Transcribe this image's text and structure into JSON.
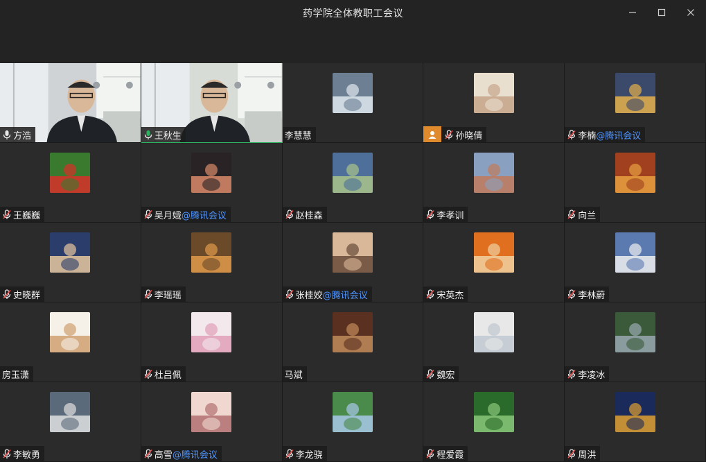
{
  "window": {
    "title": "药学院全体教职工会议",
    "controls": [
      "minimize-icon",
      "maximize-icon",
      "close-icon"
    ]
  },
  "colors": {
    "background": "#232323",
    "tile": "#2b2b2b",
    "speaking_border": "#2db35d",
    "link_blue": "#4f95ff",
    "host_badge": "#e08a2e",
    "muted_red": "#e84c4c"
  },
  "participants": [
    {
      "name": "方浩",
      "suffix": "",
      "mic": "active",
      "tile": "video"
    },
    {
      "name": "王秋生",
      "suffix": "",
      "mic": "speaking",
      "tile": "video"
    },
    {
      "name": "李慧慧",
      "suffix": "",
      "mic": "none",
      "tile": "avatar"
    },
    {
      "name": "孙晓倩",
      "suffix": "",
      "mic": "muted",
      "tile": "avatar",
      "badge": "host-icon"
    },
    {
      "name": "李楠",
      "suffix": "@腾讯会议",
      "mic": "muted",
      "tile": "avatar"
    },
    {
      "name": "王巍巍",
      "suffix": "",
      "mic": "muted",
      "tile": "avatar"
    },
    {
      "name": "吴月娥",
      "suffix": "@腾讯会议",
      "mic": "muted",
      "tile": "avatar"
    },
    {
      "name": "赵桂森",
      "suffix": "",
      "mic": "muted",
      "tile": "avatar"
    },
    {
      "name": "李孝训",
      "suffix": "",
      "mic": "muted",
      "tile": "avatar"
    },
    {
      "name": "向兰",
      "suffix": "",
      "mic": "muted",
      "tile": "avatar"
    },
    {
      "name": "史晓群",
      "suffix": "",
      "mic": "muted",
      "tile": "avatar"
    },
    {
      "name": "李瑶瑶",
      "suffix": "",
      "mic": "muted",
      "tile": "avatar"
    },
    {
      "name": "张桂姣",
      "suffix": "@腾讯会议",
      "mic": "muted",
      "tile": "avatar"
    },
    {
      "name": "宋英杰",
      "suffix": "",
      "mic": "muted",
      "tile": "avatar"
    },
    {
      "name": "李林蔚",
      "suffix": "",
      "mic": "muted",
      "tile": "avatar"
    },
    {
      "name": "房玉潇",
      "suffix": "",
      "mic": "none",
      "tile": "avatar"
    },
    {
      "name": "杜吕佩",
      "suffix": "",
      "mic": "muted",
      "tile": "avatar"
    },
    {
      "name": "马斌",
      "suffix": "",
      "mic": "none",
      "tile": "avatar"
    },
    {
      "name": "魏宏",
      "suffix": "",
      "mic": "muted",
      "tile": "avatar"
    },
    {
      "name": "李凌冰",
      "suffix": "",
      "mic": "muted",
      "tile": "avatar"
    },
    {
      "name": "李敏勇",
      "suffix": "",
      "mic": "muted",
      "tile": "avatar"
    },
    {
      "name": "高雪",
      "suffix": "@腾讯会议",
      "mic": "muted",
      "tile": "avatar"
    },
    {
      "name": "李龙骁",
      "suffix": "",
      "mic": "muted",
      "tile": "avatar"
    },
    {
      "name": "程爱霞",
      "suffix": "",
      "mic": "muted",
      "tile": "avatar"
    },
    {
      "name": "周洪",
      "suffix": "",
      "mic": "muted",
      "tile": "avatar"
    }
  ]
}
